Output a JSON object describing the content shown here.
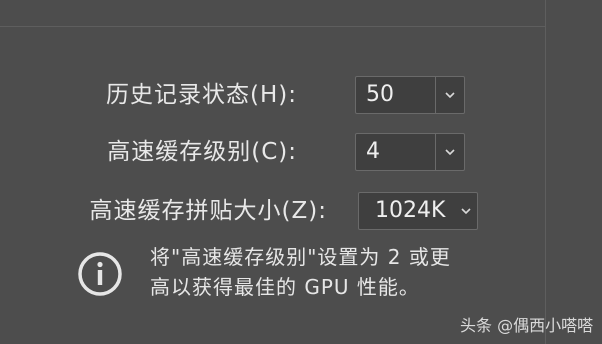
{
  "prefs": {
    "history_states": {
      "label": "历史记录状态(H):",
      "value": "50"
    },
    "cache_levels": {
      "label": "高速缓存级别(C):",
      "value": "4"
    },
    "cache_tile_size": {
      "label": "高速缓存拼贴大小(Z):",
      "value": "1024K"
    },
    "info_line1": "将\"高速缓存级别\"设置为 2 或更",
    "info_line2": "高以获得最佳的 GPU 性能。"
  },
  "watermark": "头条 @偶西小嗒嗒",
  "icons": {
    "info": "info-icon",
    "chevron": "chevron-down-icon"
  },
  "colors": {
    "background": "#4d4d4d",
    "field": "#3f3f3f",
    "border": "#6a6a6a",
    "text": "#e6e6e6"
  }
}
